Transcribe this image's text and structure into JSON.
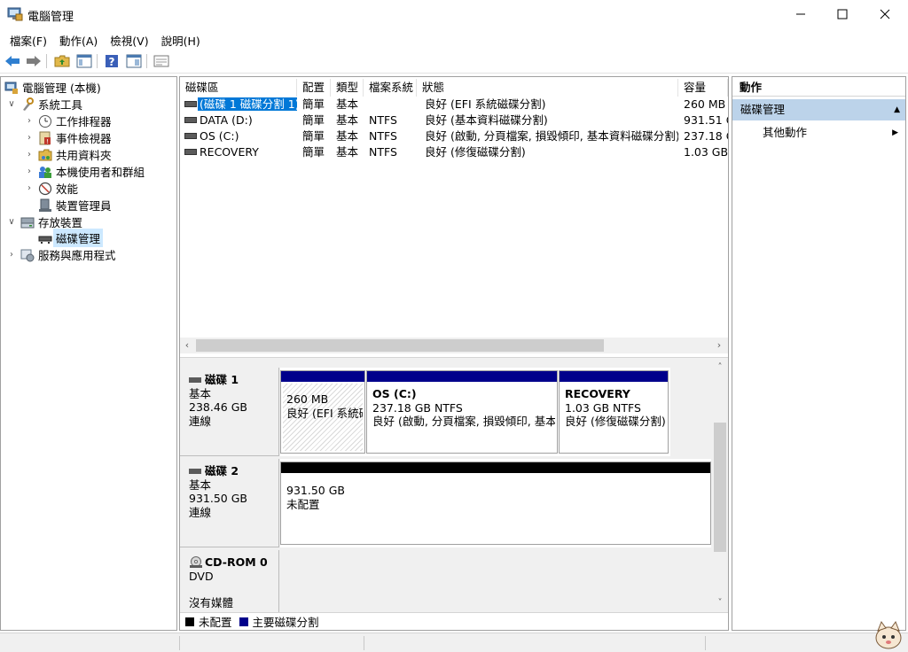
{
  "window": {
    "title": "電腦管理"
  },
  "menu": [
    "檔案(F)",
    "動作(A)",
    "檢視(V)",
    "說明(H)"
  ],
  "tree": [
    {
      "label": "電腦管理 (本機)",
      "indent": 0,
      "exp": "",
      "icon": "computer-management-icon"
    },
    {
      "label": "系統工具",
      "indent": 1,
      "exp": "∨",
      "icon": "system-tools-icon"
    },
    {
      "label": "工作排程器",
      "indent": 2,
      "exp": "›",
      "icon": "clock-icon"
    },
    {
      "label": "事件檢視器",
      "indent": 2,
      "exp": "›",
      "icon": "event-viewer-icon"
    },
    {
      "label": "共用資料夾",
      "indent": 2,
      "exp": "›",
      "icon": "shared-folder-icon"
    },
    {
      "label": "本機使用者和群組",
      "indent": 2,
      "exp": "›",
      "icon": "users-icon"
    },
    {
      "label": "效能",
      "indent": 2,
      "exp": "›",
      "icon": "performance-icon"
    },
    {
      "label": "裝置管理員",
      "indent": 2,
      "exp": "",
      "icon": "device-manager-icon"
    },
    {
      "label": "存放裝置",
      "indent": 1,
      "exp": "∨",
      "icon": "storage-icon"
    },
    {
      "label": "磁碟管理",
      "indent": 2,
      "exp": "",
      "icon": "disk-icon",
      "selected": true
    },
    {
      "label": "服務與應用程式",
      "indent": 1,
      "exp": "›",
      "icon": "services-icon"
    }
  ],
  "volume_columns": [
    "磁碟區",
    "配置",
    "類型",
    "檔案系統",
    "狀態",
    "容量"
  ],
  "volumes": [
    {
      "name": "(磁碟 1 磁碟分割 1)",
      "layout": "簡單",
      "type": "基本",
      "fs": "",
      "status": "良好 (EFI 系統磁碟分割)",
      "capacity": "260 MB",
      "selected": true
    },
    {
      "name": "DATA (D:)",
      "layout": "簡單",
      "type": "基本",
      "fs": "NTFS",
      "status": "良好 (基本資料磁碟分割)",
      "capacity": "931.51 G"
    },
    {
      "name": "OS (C:)",
      "layout": "簡單",
      "type": "基本",
      "fs": "NTFS",
      "status": "良好 (啟動, 分頁檔案, 損毀傾印, 基本資料磁碟分割)",
      "capacity": "237.18 G"
    },
    {
      "name": "RECOVERY",
      "layout": "簡單",
      "type": "基本",
      "fs": "NTFS",
      "status": "良好 (修復磁碟分割)",
      "capacity": "1.03 GB"
    }
  ],
  "disks": [
    {
      "name": "磁碟 1",
      "type": "基本",
      "size": "238.46 GB",
      "state": "連線",
      "partitions": [
        {
          "title": "",
          "size": "260 MB",
          "status": "良好 (EFI 系統磁碟分割)",
          "bar": "#00008b"
        },
        {
          "title": "OS  (C:)",
          "size": "237.18 GB NTFS",
          "status": "良好 (啟動, 分頁檔案, 損毀傾印, 基本資料磁碟分割)",
          "bar": "#00008b"
        },
        {
          "title": "RECOVERY",
          "size": "1.03 GB NTFS",
          "status": "良好 (修復磁碟分割)",
          "bar": "#00008b"
        }
      ]
    },
    {
      "name": "磁碟 2",
      "type": "基本",
      "size": "931.50 GB",
      "state": "連線",
      "partitions": [
        {
          "title": "",
          "size": "931.50 GB",
          "status": "未配置",
          "bar": "#000000"
        }
      ]
    },
    {
      "name": "CD-ROM 0",
      "type": "DVD",
      "size": "",
      "state": "沒有媒體",
      "partitions": []
    }
  ],
  "legend": [
    {
      "label": "未配置",
      "color": "#000000"
    },
    {
      "label": "主要磁碟分割",
      "color": "#00008b"
    }
  ],
  "actions": {
    "title": "動作",
    "section": "磁碟管理",
    "item": "其他動作"
  }
}
